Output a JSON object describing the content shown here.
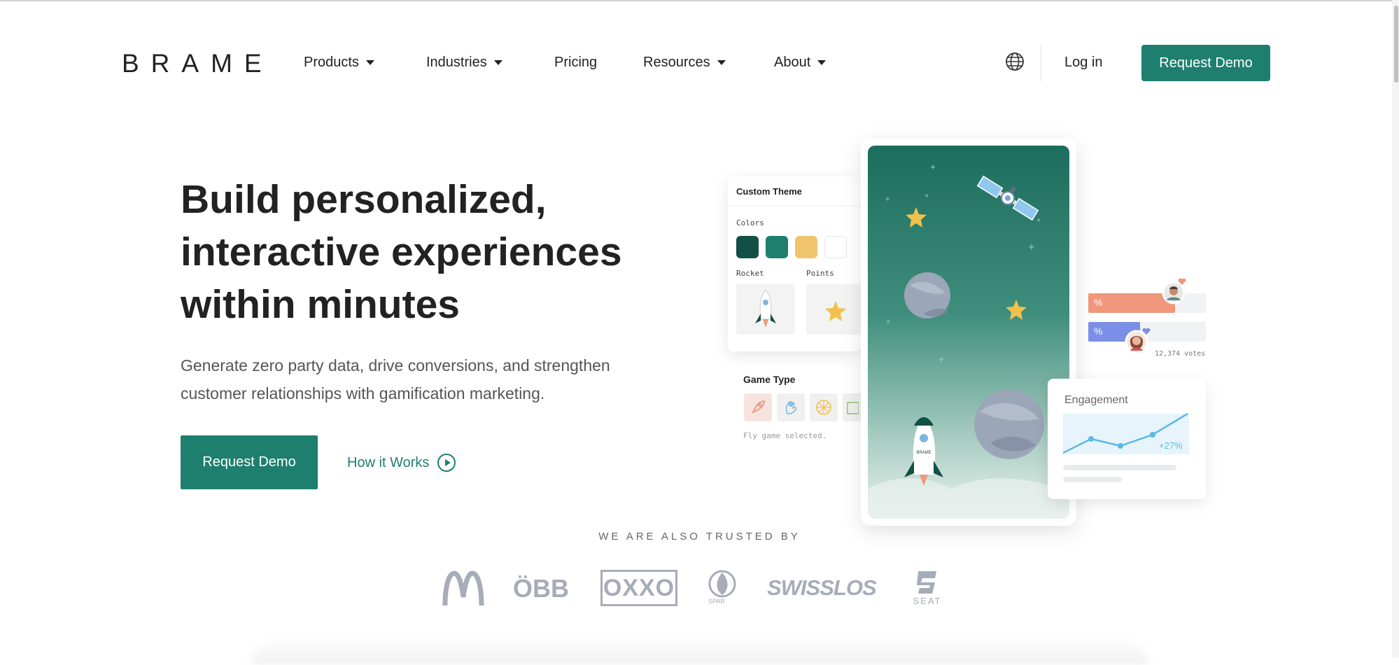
{
  "nav": {
    "logo": "BRAME",
    "items": [
      {
        "label": "Products",
        "dropdown": true
      },
      {
        "label": "Industries",
        "dropdown": true
      },
      {
        "label": "Pricing",
        "dropdown": false
      },
      {
        "label": "Resources",
        "dropdown": true
      },
      {
        "label": "About",
        "dropdown": true
      }
    ],
    "login": "Log in",
    "cta": "Request Demo",
    "globe_icon": "globe-icon"
  },
  "hero": {
    "title_lines": [
      "Build personalized,",
      "interactive experiences",
      "within minutes"
    ],
    "subtitle_lines": [
      "Generate zero party data, drive conversions, and strengthen",
      "customer relationships with gamification marketing."
    ],
    "cta": "Request Demo",
    "secondary": "How it Works"
  },
  "illustration": {
    "theme_card": {
      "title": "Custom Theme",
      "colors_label": "Colors",
      "swatches": [
        "#124f44",
        "#1e7f6e",
        "#f0c36d",
        "#ffffff"
      ],
      "rocket_label": "Rocket",
      "points_label": "Points"
    },
    "game_type": {
      "title": "Game Type",
      "status": "Fly game selected."
    },
    "poll": {
      "symbol": "%",
      "bars": [
        {
          "color": "#f0977c",
          "fill": 0.74
        },
        {
          "color": "#7b8fe8",
          "fill": 0.44
        }
      ],
      "votes": "12,374 votes"
    },
    "engagement": {
      "title": "Engagement",
      "change": "+27%"
    },
    "rocket_text": "BRAME"
  },
  "trusted": {
    "heading": "WE ARE ALSO TRUSTED BY",
    "brands": [
      "ÖBB",
      "OXXO",
      "SPAR",
      "SWISSLOS",
      "SEAT"
    ]
  },
  "colors": {
    "accent": "#1e7f6e",
    "text": "#222222",
    "muted": "#555555",
    "brand_gray": "#a6acb8"
  }
}
